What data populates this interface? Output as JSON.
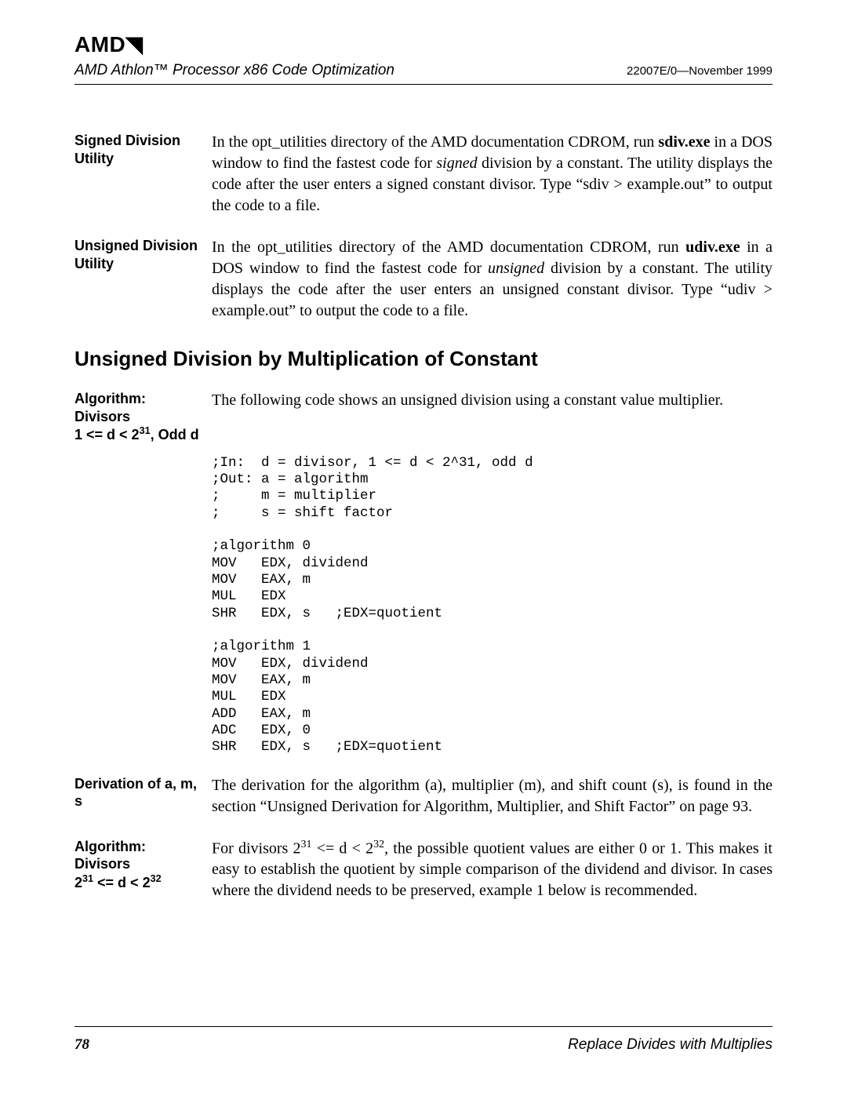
{
  "header": {
    "logo": "AMD",
    "doc_title": "AMD Athlon™ Processor x86 Code Optimization",
    "doc_meta": "22007E/0—November 1999"
  },
  "sections": {
    "signed_div": {
      "label": "Signed Division Utility",
      "body_pre": "In the opt_utilities directory of the AMD documentation CDROM, run ",
      "body_bold": "sdiv.exe",
      "body_mid": " in a DOS window to find the fastest code for ",
      "body_em": "signed",
      "body_post": " division by a constant. The utility displays the code after the user enters a signed constant divisor. Type “sdiv > example.out” to output the code to a file."
    },
    "unsigned_div": {
      "label": "Unsigned Division Utility",
      "body_pre": "In the opt_utilities directory of the AMD documentation CDROM, run ",
      "body_bold": "udiv.exe",
      "body_mid": " in a DOS window to find the fastest code for ",
      "body_em": "unsigned",
      "body_post": " division by a constant. The utility displays the code after the user enters an unsigned constant divisor. Type “udiv > example.out” to output the code to a file."
    },
    "h2": "Unsigned Division by Multiplication of Constant",
    "alg1": {
      "label_l1": "Algorithm: Divisors",
      "label_l2a": "1 <= d < 2",
      "label_l2sup": "31",
      "label_l2b": ", Odd d",
      "body": "The following code shows an unsigned division using a constant value multiplier."
    },
    "code": ";In:  d = divisor, 1 <= d < 2^31, odd d\n;Out: a = algorithm\n;     m = multiplier\n;     s = shift factor\n\n;algorithm 0\nMOV   EDX, dividend\nMOV   EAX, m\nMUL   EDX\nSHR   EDX, s   ;EDX=quotient\n\n;algorithm 1\nMOV   EDX, dividend\nMOV   EAX, m\nMUL   EDX\nADD   EAX, m\nADC   EDX, 0\nSHR   EDX, s   ;EDX=quotient",
    "deriv": {
      "label": "Derivation of a, m, s",
      "body": "The derivation for the algorithm (a), multiplier (m), and shift count (s), is found in the section “Unsigned Derivation for Algorithm, Multiplier, and Shift Factor” on page 93."
    },
    "alg2": {
      "label_l1": "Algorithm: Divisors",
      "label_l2a": "2",
      "label_sup1": "31",
      "label_mid": " <= d < 2",
      "label_sup2": "32",
      "body_pre": "For divisors 2",
      "body_sup1": "31",
      "body_mid1": " <= d < 2",
      "body_sup2": "32",
      "body_post": ", the possible quotient values are either 0 or 1. This makes it easy to establish the quotient by simple comparison of the dividend and divisor. In cases where the dividend needs to be preserved, example 1 below is recommended."
    }
  },
  "footer": {
    "page": "78",
    "title": "Replace Divides with Multiplies"
  }
}
